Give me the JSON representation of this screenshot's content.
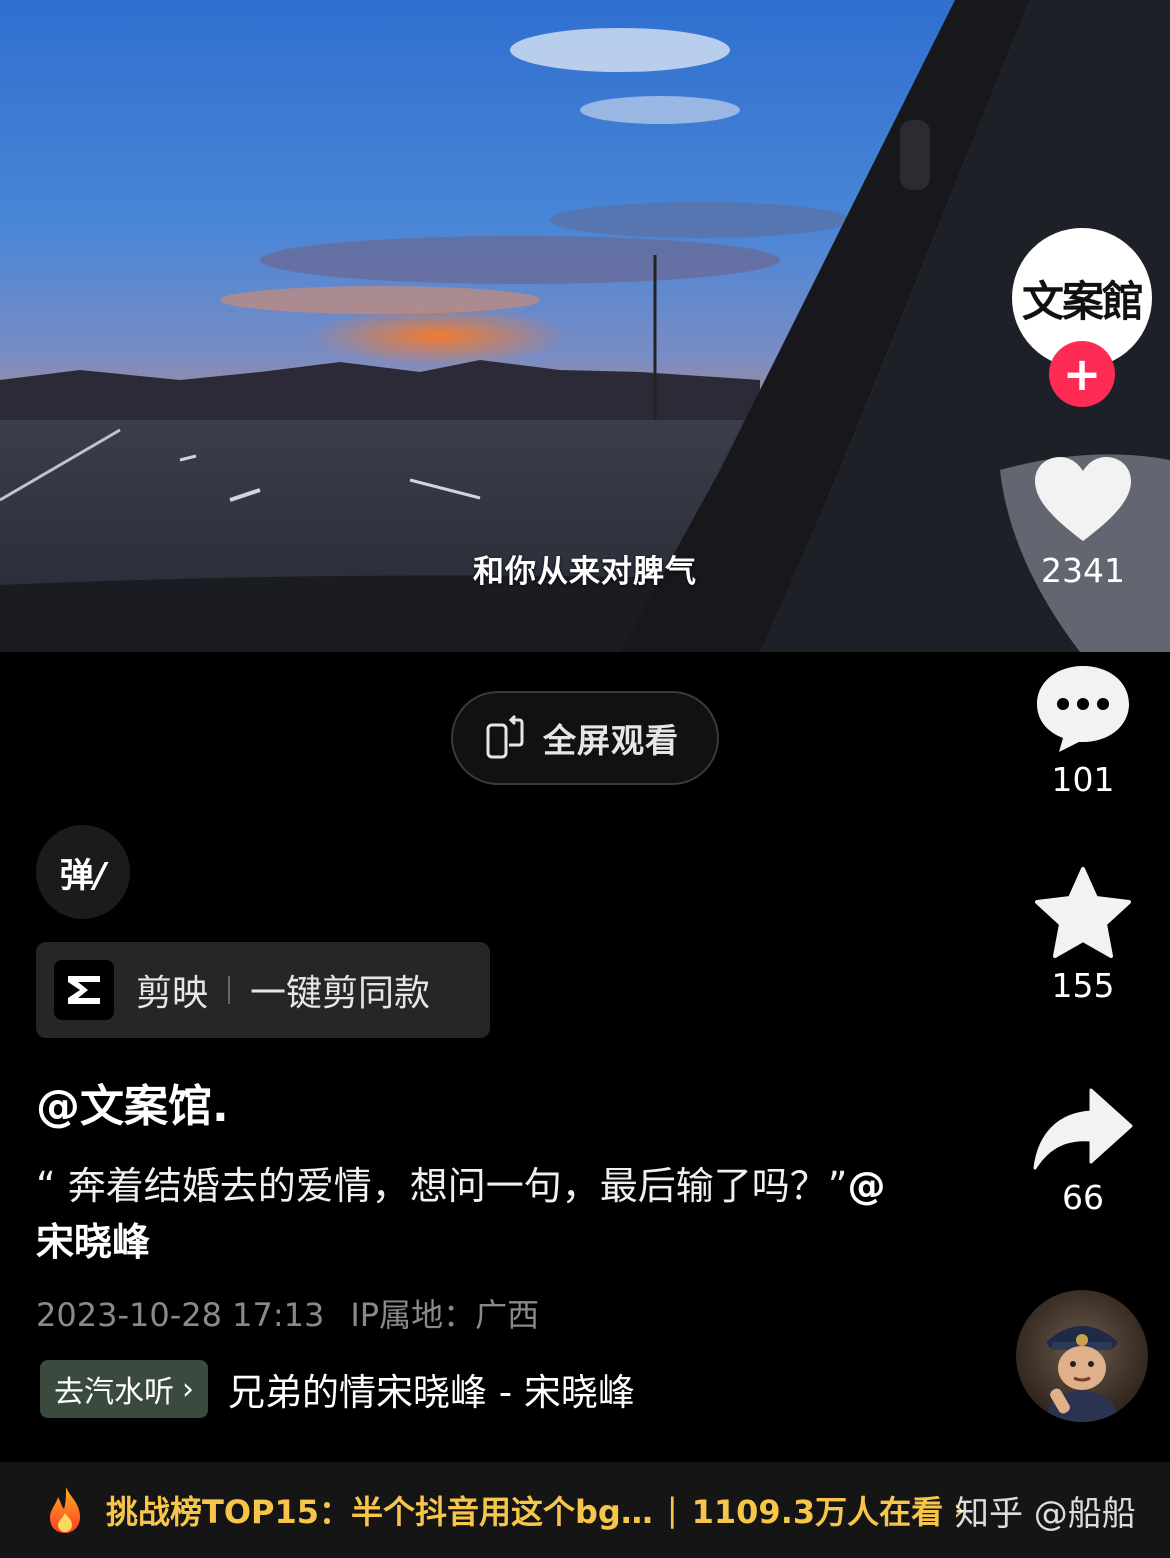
{
  "video": {
    "subtitle": "和你从来对脾气"
  },
  "fullscreen_button": {
    "label": "全屏观看",
    "icon": "rotate-phone-icon"
  },
  "danmaku_button": {
    "label": "弹",
    "icon": "danmaku-icon"
  },
  "capcut": {
    "app_name": "剪映",
    "action": "一键剪同款",
    "icon": "capcut-logo-icon"
  },
  "post": {
    "author": "@文案馆.",
    "description": "“ 奔着结婚去的爱情，想问一句，最后输了吗？”",
    "mention": "@宋晓峰",
    "date": "2023-10-28 17:13",
    "ip_location": "IP属地：广西"
  },
  "music": {
    "tag_label": "去汽水听",
    "title": "兄弟的情宋晓峰 - 宋晓峰"
  },
  "sidebar": {
    "avatar_text": "文案館",
    "follow_label": "+",
    "like_count": "2341",
    "comment_count": "101",
    "favorite_count": "155",
    "share_count": "66"
  },
  "bottom_banner": {
    "text": "挑战榜TOP15：半个抖音用这个bg…",
    "viewers": "1109.3万人在看",
    "icon": "flame-icon"
  },
  "watermark": "知乎 @船船",
  "colors": {
    "follow": "#fe2c55",
    "banner_text": "#f6c54a",
    "music_tag_bg": "#3a4a3f"
  }
}
